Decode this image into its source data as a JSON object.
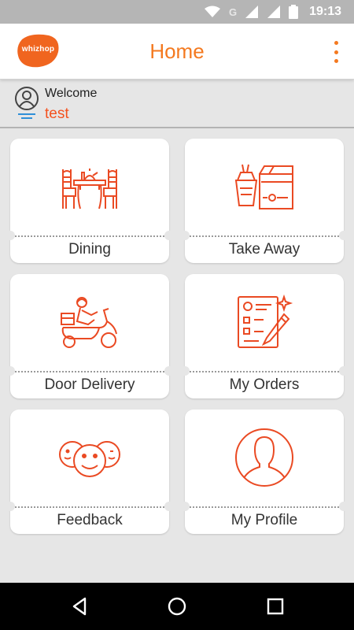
{
  "status_bar": {
    "time": "19:13",
    "network_label": "G",
    "icons": [
      "wifi-icon",
      "signal-icon",
      "lte-signal-icon",
      "battery-icon"
    ]
  },
  "app_bar": {
    "logo_text": "whizhop",
    "title": "Home",
    "menu_icon": "overflow-menu-icon"
  },
  "welcome": {
    "label": "Welcome",
    "username": "test",
    "icon": "user-avatar-icon"
  },
  "tiles": [
    {
      "label": "Dining",
      "icon": "dining-table-icon"
    },
    {
      "label": "Take Away",
      "icon": "takeaway-bag-icon"
    },
    {
      "label": "Door Delivery",
      "icon": "delivery-scooter-icon"
    },
    {
      "label": "My Orders",
      "icon": "order-list-icon"
    },
    {
      "label": "Feedback",
      "icon": "smiley-faces-icon"
    },
    {
      "label": "My Profile",
      "icon": "profile-silhouette-icon"
    }
  ],
  "colors": {
    "accent": "#f4791f",
    "icon_red": "#ea4a23",
    "background": "#e6e6e6"
  },
  "nav_bar": {
    "icons": [
      "back-icon",
      "home-icon",
      "recents-icon"
    ]
  }
}
